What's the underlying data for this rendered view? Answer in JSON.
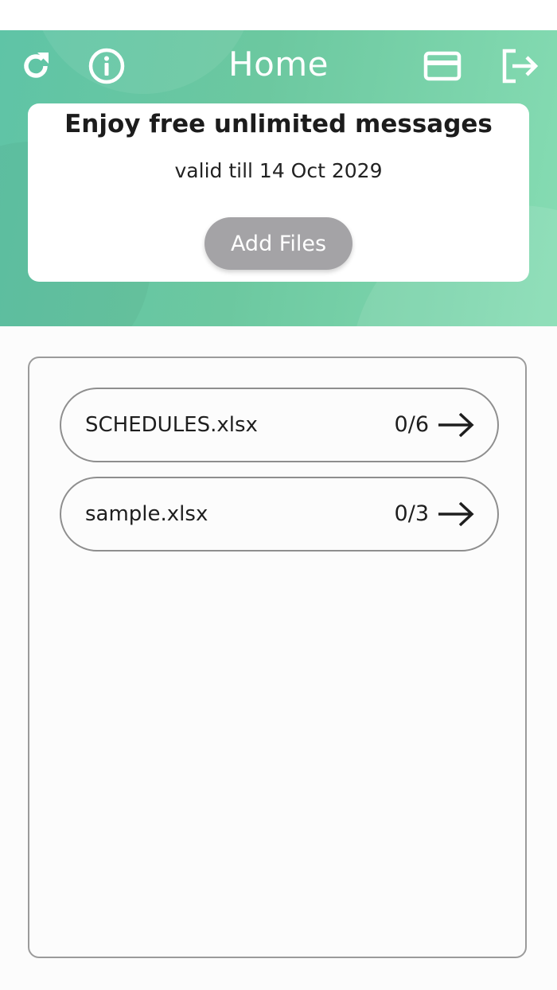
{
  "header": {
    "title": "Home",
    "icons": {
      "left": [
        "refresh-icon",
        "info-icon"
      ],
      "right": [
        "card-icon",
        "logout-icon"
      ]
    }
  },
  "promo": {
    "title": "Enjoy free unlimited messages",
    "validity": "valid till 14 Oct 2029",
    "button_label": "Add Files"
  },
  "files": [
    {
      "name": "SCHEDULES.xlsx",
      "progress": "0/6"
    },
    {
      "name": "sample.xlsx",
      "progress": "0/3"
    }
  ],
  "colors": {
    "header_start": "#5fc4a6",
    "header_end": "#86dcb3",
    "button_gray": "#a4a3a6"
  }
}
